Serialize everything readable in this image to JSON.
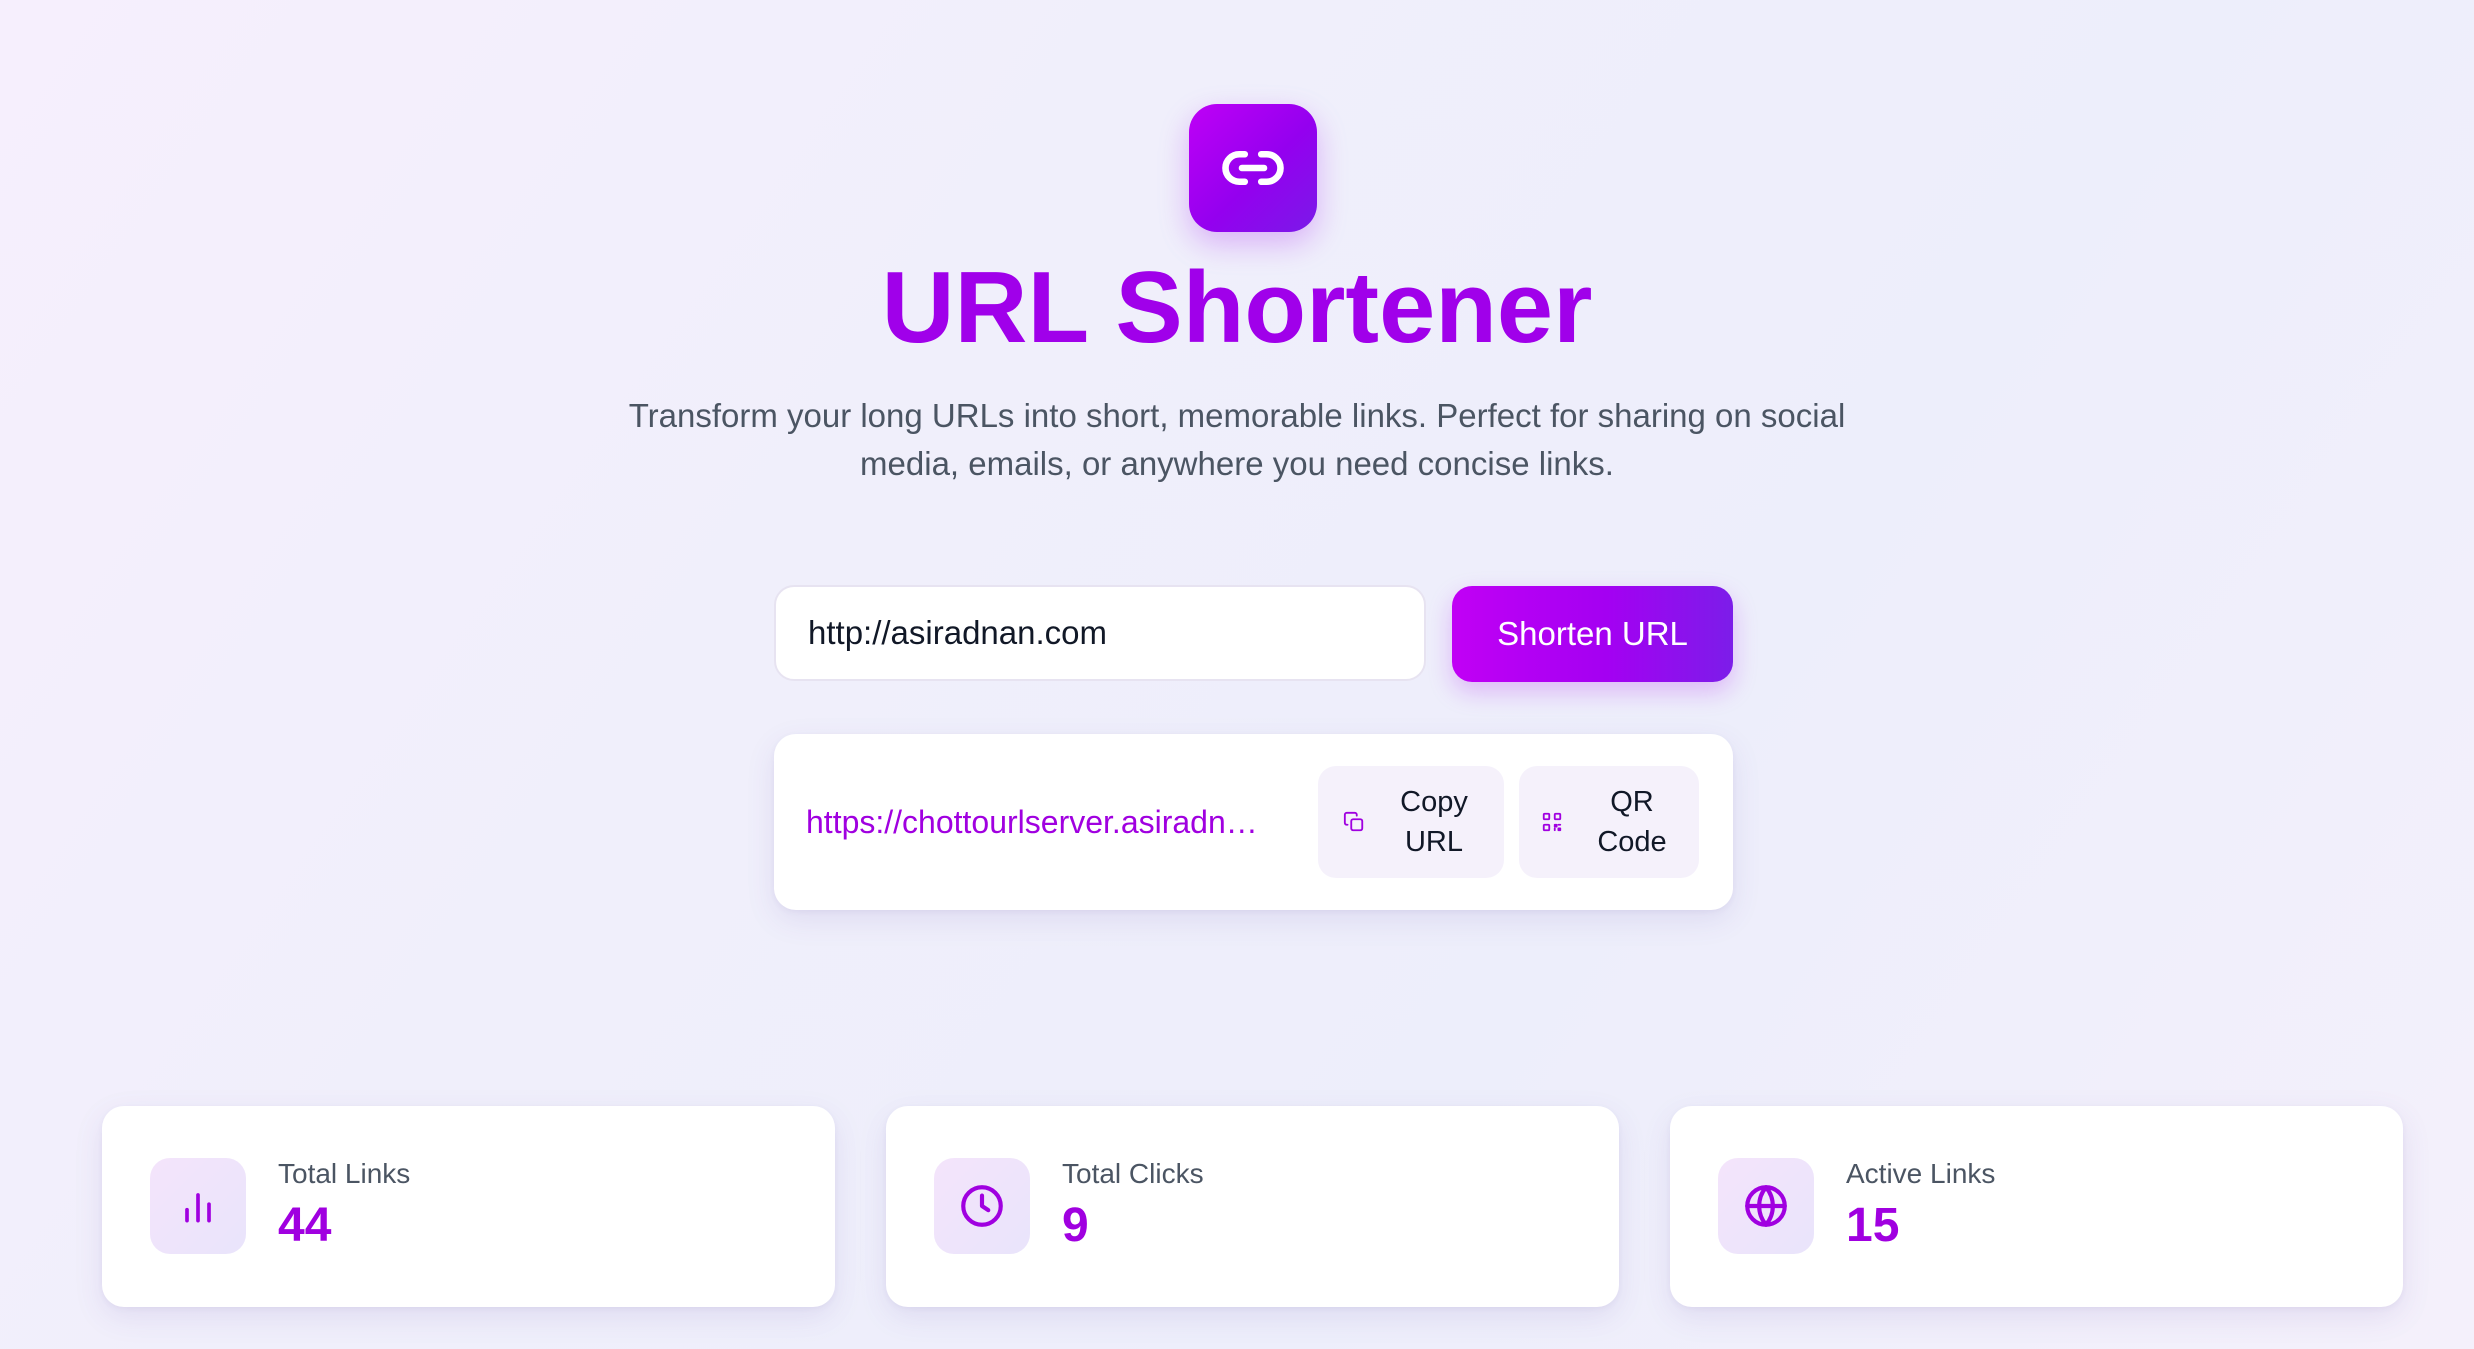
{
  "header": {
    "title": "URL Shortener",
    "subtitle": "Transform your long URLs into short, memorable links. Perfect for sharing on social media, emails, or anywhere you need concise links."
  },
  "form": {
    "input_value": "http://asiradnan.com",
    "shorten_label": "Shorten URL"
  },
  "result": {
    "short_url": "https://chottourlserver.asiradnan.com/",
    "copy_label_line1": "Copy",
    "copy_label_line2": "URL",
    "qr_label_line1": "QR",
    "qr_label_line2": "Code"
  },
  "stats": [
    {
      "label": "Total Links",
      "value": "44",
      "icon": "bar-chart-icon"
    },
    {
      "label": "Total Clicks",
      "value": "9",
      "icon": "clock-icon"
    },
    {
      "label": "Active Links",
      "value": "15",
      "icon": "globe-icon"
    }
  ],
  "colors": {
    "accent": "#a000ea",
    "accent_gradient_start": "#c100f5",
    "accent_gradient_end": "#7c1de9",
    "text_muted": "#4b5563"
  }
}
